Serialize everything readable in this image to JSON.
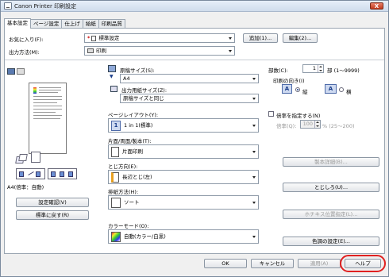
{
  "window": {
    "title": "Canon Printer 印刷設定",
    "close_label": "X"
  },
  "tabs": [
    {
      "label": "基本設定",
      "active": true
    },
    {
      "label": "ページ設定"
    },
    {
      "label": "仕上げ"
    },
    {
      "label": "給紙"
    },
    {
      "label": "印刷品質"
    }
  ],
  "top": {
    "favorites_label": "お気に入り(F):",
    "favorites_value": "標準設定",
    "add_button": "追加(1)...",
    "edit_button": "編集(2)...",
    "output_label": "出力方法(M):",
    "output_value": "印刷"
  },
  "preview": {
    "caption": "A4(倍率：自動)",
    "confirm_button": "設定確認(V)",
    "restore_button": "標準に戻す(R)"
  },
  "middle": {
    "orig_size_label": "原稿サイズ(S):",
    "orig_size_value": "A4",
    "out_size_label": "出力用紙サイズ(Z):",
    "out_size_value": "原稿サイズと同じ",
    "layout_label": "ページレイアウト(Y):",
    "layout_value": "1 in 1(標準)",
    "duplex_label": "片面/両面/製本(T):",
    "duplex_value": "片面印刷",
    "binding_label": "とじ方向(E):",
    "binding_value": "長辺とじ(左)",
    "output_order_label": "排紙方法(H):",
    "output_order_value": "ソート",
    "color_label": "カラーモード(O):",
    "color_value": "自動(カラー/白黒)"
  },
  "right": {
    "copies_label": "部数(C):",
    "copies_value": "1",
    "copies_range": "部 (1〜9999)",
    "orientation_label": "印刷の向き(I)",
    "portrait_label": "縦",
    "landscape_label": "横",
    "scale_check_label": "倍率を指定する(N)",
    "scale_label": "倍率(Q):",
    "scale_value": "100",
    "scale_range": "% (25〜200)",
    "booklet_button": "製本詳細(B)...",
    "binding_button": "とじしろ(U)...",
    "staple_button": "ホチキス位置指定(L)...",
    "color_detail_button": "色調の設定(E)..."
  },
  "bottom": {
    "ok": "OK",
    "cancel": "キャンセル",
    "apply": "適用(A)",
    "help": "ヘルプ"
  },
  "colors": {
    "highlight_ring": "#e02020",
    "accent": "#1a3d8a"
  }
}
